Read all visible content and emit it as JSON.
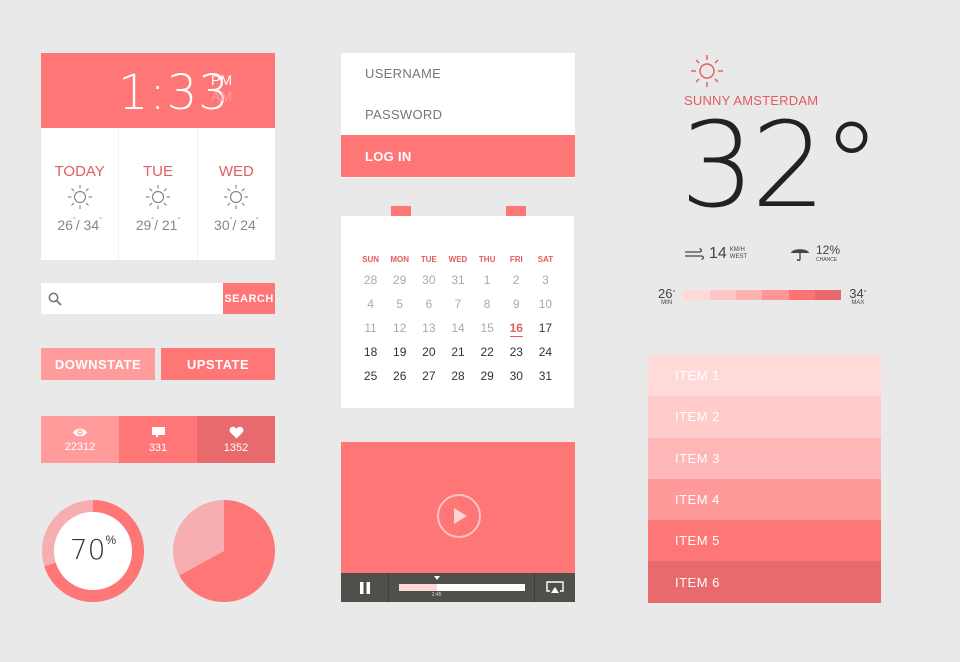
{
  "colors": {
    "accent": "#ff7676",
    "accent_light": "#ff9b9b",
    "accent_dark": "#e86a6c",
    "text_red": "#e05d60",
    "background": "#e9e9e9",
    "dark_bar": "#4f4f4c"
  },
  "clock": {
    "time": "1:33",
    "pm": "PM",
    "am": "AM",
    "forecast": [
      {
        "day": "TODAY",
        "icon": "sun-icon",
        "low": "26",
        "high": "34"
      },
      {
        "day": "TUE",
        "icon": "sun-icon",
        "low": "29",
        "high": "21"
      },
      {
        "day": "WED",
        "icon": "sun-icon",
        "low": "30",
        "high": "24"
      }
    ]
  },
  "search": {
    "placeholder": "",
    "value": "",
    "button": "SEARCH"
  },
  "buttons": {
    "downstate": "DOWNSTATE",
    "upstate": "UPSTATE"
  },
  "stats": [
    {
      "icon": "eye-icon",
      "value": "22312",
      "color": "#ff9b9b"
    },
    {
      "icon": "comment-icon",
      "value": "331",
      "color": "#ff7676"
    },
    {
      "icon": "heart-icon",
      "value": "1352",
      "color": "#e86a6c"
    }
  ],
  "progress": {
    "donut_percent": 70,
    "donut_label": "70",
    "donut_unit": "%",
    "pie_percent": 67
  },
  "login": {
    "username_placeholder": "USERNAME",
    "password_placeholder": "PASSWORD",
    "button": "LOG IN"
  },
  "calendar": {
    "weekdays": [
      "SUN",
      "MON",
      "TUE",
      "WED",
      "THU",
      "FRI",
      "SAT"
    ],
    "weeks": [
      [
        "28",
        "29",
        "30",
        "31",
        "1",
        "2",
        "3"
      ],
      [
        "4",
        "5",
        "6",
        "7",
        "8",
        "9",
        "10"
      ],
      [
        "11",
        "12",
        "13",
        "14",
        "15",
        "16",
        "17"
      ],
      [
        "18",
        "19",
        "20",
        "21",
        "22",
        "23",
        "24"
      ],
      [
        "25",
        "26",
        "27",
        "28",
        "29",
        "30",
        "31"
      ]
    ],
    "today": "16",
    "today_week": 2,
    "today_col": 5
  },
  "video": {
    "timestamp": "2:45",
    "progress_fraction": 0.3
  },
  "weather": {
    "condition_city": "SUNNY AMSTERDAM",
    "temperature": "32°",
    "wind_speed": "14",
    "wind_unit": "KM/H",
    "wind_dir": "WEST",
    "rain_chance": "12%",
    "rain_label": "CHANCE",
    "min_temp": "26",
    "min_label": "MIN",
    "max_temp": "34",
    "max_label": "MAX",
    "range_colors": [
      "#ffd9d9",
      "#ffc6c7",
      "#ffb1b2",
      "#ff9597",
      "#ff7274",
      "#e86a6c"
    ]
  },
  "list": {
    "items": [
      {
        "label": "ITEM 1",
        "color": "#ffdad9"
      },
      {
        "label": "ITEM 2",
        "color": "#ffcbcb"
      },
      {
        "label": "ITEM 3",
        "color": "#ffb6b6"
      },
      {
        "label": "ITEM 4",
        "color": "#ff9a9a"
      },
      {
        "label": "ITEM 5",
        "color": "#ff7676"
      },
      {
        "label": "ITEM 6",
        "color": "#e86a6c"
      }
    ]
  }
}
